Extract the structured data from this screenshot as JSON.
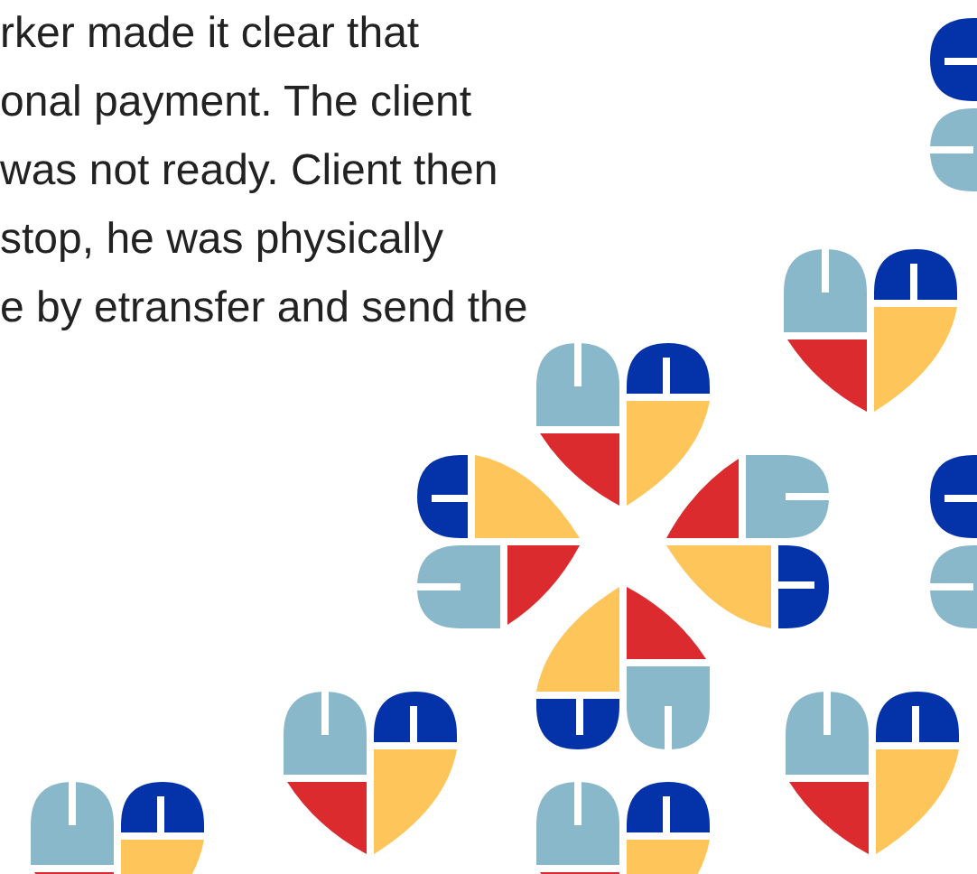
{
  "paragraph": {
    "lines": [
      "rker made it clear that",
      "onal payment. The client",
      "was not ready. Client then",
      "stop, he was physically",
      "e by etransfer and send the"
    ]
  }
}
